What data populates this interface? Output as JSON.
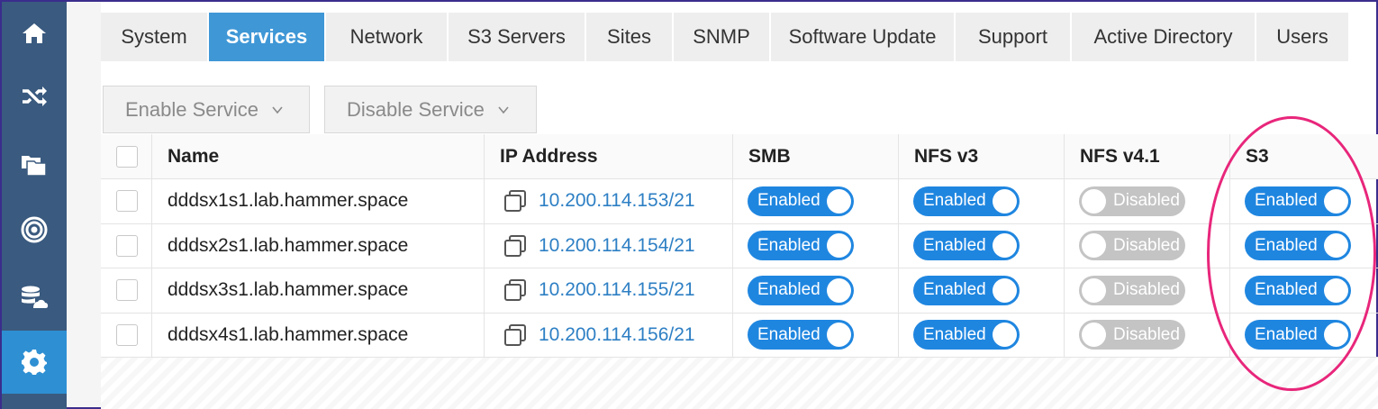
{
  "sidebar": {
    "items": [
      {
        "icon": "home-icon"
      },
      {
        "icon": "shuffle-icon"
      },
      {
        "icon": "files-icon"
      },
      {
        "icon": "target-icon"
      },
      {
        "icon": "cloud-database-icon"
      },
      {
        "icon": "gear-icon",
        "active": true
      }
    ]
  },
  "tabs": [
    {
      "label": "System"
    },
    {
      "label": "Services",
      "active": true
    },
    {
      "label": "Network"
    },
    {
      "label": "S3 Servers"
    },
    {
      "label": "Sites"
    },
    {
      "label": "SNMP"
    },
    {
      "label": "Software Update"
    },
    {
      "label": "Support"
    },
    {
      "label": "Active Directory"
    },
    {
      "label": "Users"
    }
  ],
  "toolbar": {
    "enable_label": "Enable Service",
    "disable_label": "Disable Service"
  },
  "table": {
    "headers": {
      "name": "Name",
      "ip": "IP Address",
      "smb": "SMB",
      "nfs3": "NFS v3",
      "nfs41": "NFS v4.1",
      "s3": "S3"
    },
    "rows": [
      {
        "name": "dddsx1s1.lab.hammer.space",
        "ip": "10.200.114.153/21",
        "smb": "Enabled",
        "nfs3": "Enabled",
        "nfs41": "Disabled",
        "s3": "Enabled"
      },
      {
        "name": "dddsx2s1.lab.hammer.space",
        "ip": "10.200.114.154/21",
        "smb": "Enabled",
        "nfs3": "Enabled",
        "nfs41": "Disabled",
        "s3": "Enabled"
      },
      {
        "name": "dddsx3s1.lab.hammer.space",
        "ip": "10.200.114.155/21",
        "smb": "Enabled",
        "nfs3": "Enabled",
        "nfs41": "Disabled",
        "s3": "Enabled"
      },
      {
        "name": "dddsx4s1.lab.hammer.space",
        "ip": "10.200.114.156/21",
        "smb": "Enabled",
        "nfs3": "Enabled",
        "nfs41": "Disabled",
        "s3": "Enabled"
      }
    ]
  },
  "colors": {
    "sidebar": "#3a5a7f",
    "accent": "#3f97d6",
    "toggle_on": "#1f86e0",
    "toggle_off": "#c4c4c4",
    "link": "#2d7fc4",
    "highlight": "#e8267b"
  }
}
